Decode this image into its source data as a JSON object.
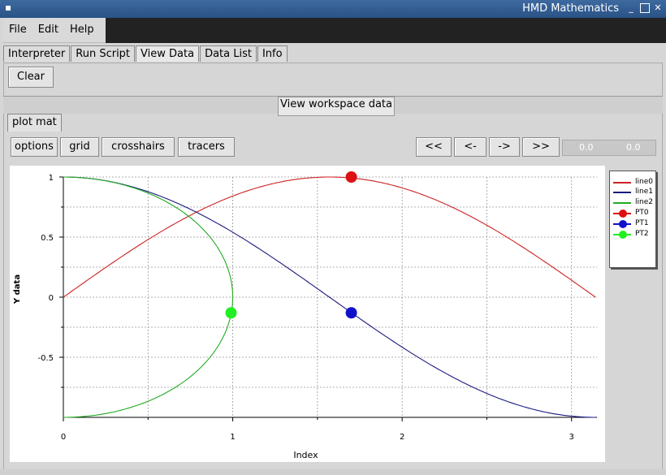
{
  "window": {
    "title": "HMD Mathematics",
    "sys_icon": "▪"
  },
  "menu": [
    "File",
    "Edit",
    "Help"
  ],
  "tabs": [
    {
      "label": "Interpreter"
    },
    {
      "label": "Run Script"
    },
    {
      "label": "View Data",
      "active": true
    },
    {
      "label": "Data List"
    },
    {
      "label": "Info"
    }
  ],
  "toolbar": {
    "clear_label": "Clear"
  },
  "view_header": "View workspace data",
  "subtab": "plot mat",
  "plot_toolbar": {
    "options": "options",
    "grid": "grid",
    "crosshairs": "crosshairs",
    "tracers": "tracers",
    "first": "<<",
    "prev": "<-",
    "next": "->",
    "last": ">>",
    "readout_x": "0.0",
    "readout_y": "0.0"
  },
  "chart_data": {
    "type": "line",
    "xlabel": "Index",
    "ylabel": "Y data",
    "xlim": [
      0,
      3.15
    ],
    "ylim": [
      -1,
      1
    ],
    "xticks": [
      0,
      1,
      2,
      3
    ],
    "yticks": [
      1,
      0.5,
      0,
      -0.5
    ],
    "ytick_labels": [
      "1",
      "0.5",
      "0",
      "-0.5"
    ],
    "grid": true,
    "legend_position": "top-right",
    "series": [
      {
        "name": "line0",
        "color": "#cc2222",
        "function": "sin(x)",
        "x_range": [
          0,
          3.14159
        ]
      },
      {
        "name": "line1",
        "color": "#1a1a80",
        "function": "cos(x)",
        "x_range": [
          0,
          3.14159
        ]
      },
      {
        "name": "line2",
        "color": "#22aa22",
        "parametric": "x=sin(t), y=cos(t)",
        "t_range": [
          0,
          3.14159
        ]
      }
    ],
    "points": [
      {
        "name": "PT0",
        "color": "#dd1111",
        "x": 1.7,
        "y": 1.0
      },
      {
        "name": "PT1",
        "color": "#1111cc",
        "x": 1.7,
        "y": -0.13
      },
      {
        "name": "PT2",
        "color": "#22ee22",
        "x": 0.99,
        "y": -0.13
      }
    ]
  }
}
